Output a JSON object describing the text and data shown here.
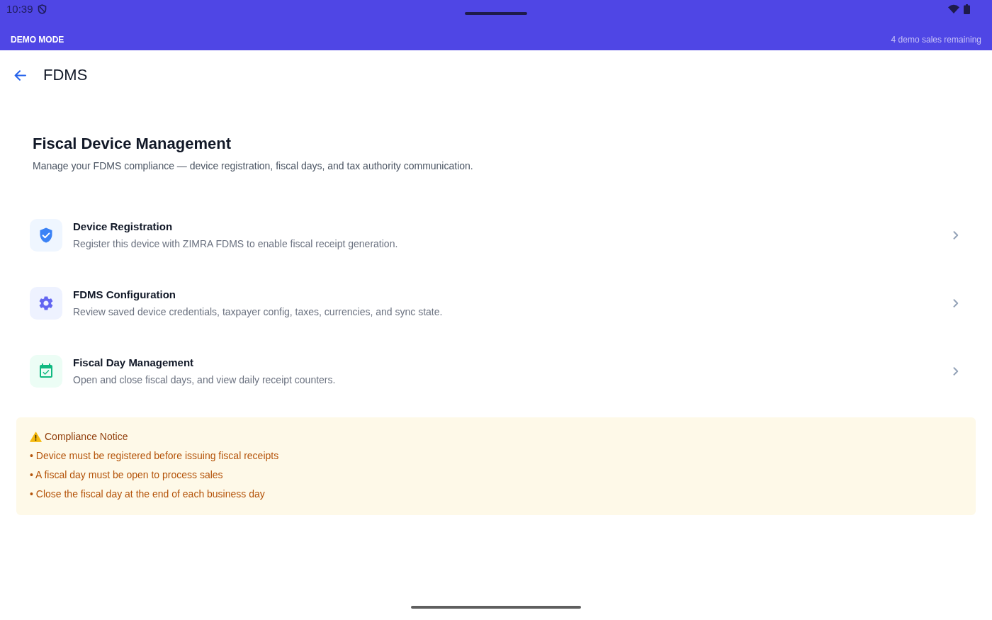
{
  "status_bar": {
    "time": "10:39"
  },
  "demo_banner": {
    "label": "DEMO MODE",
    "remaining": "4 demo sales remaining"
  },
  "app_bar": {
    "title": "FDMS"
  },
  "header": {
    "title": "Fiscal Device Management",
    "subtitle": "Manage your FDMS compliance — device registration, fiscal days, and tax authority communication."
  },
  "menu_items": [
    {
      "kind": "registration",
      "title": "Device Registration",
      "description": "Register this device with ZIMRA FDMS to enable fiscal receipt generation."
    },
    {
      "kind": "configuration",
      "title": "FDMS Configuration",
      "description": "Review saved device credentials, taxpayer config, taxes, currencies, and sync state."
    },
    {
      "kind": "fiscal_day",
      "title": "Fiscal Day Management",
      "description": "Open and close fiscal days, and view daily receipt counters."
    }
  ],
  "notice": {
    "title": "Compliance Notice",
    "items": [
      "• Device must be registered before issuing fiscal receipts",
      "• A fiscal day must be open to process sales",
      "• Close the fiscal day at the end of each business day"
    ]
  }
}
